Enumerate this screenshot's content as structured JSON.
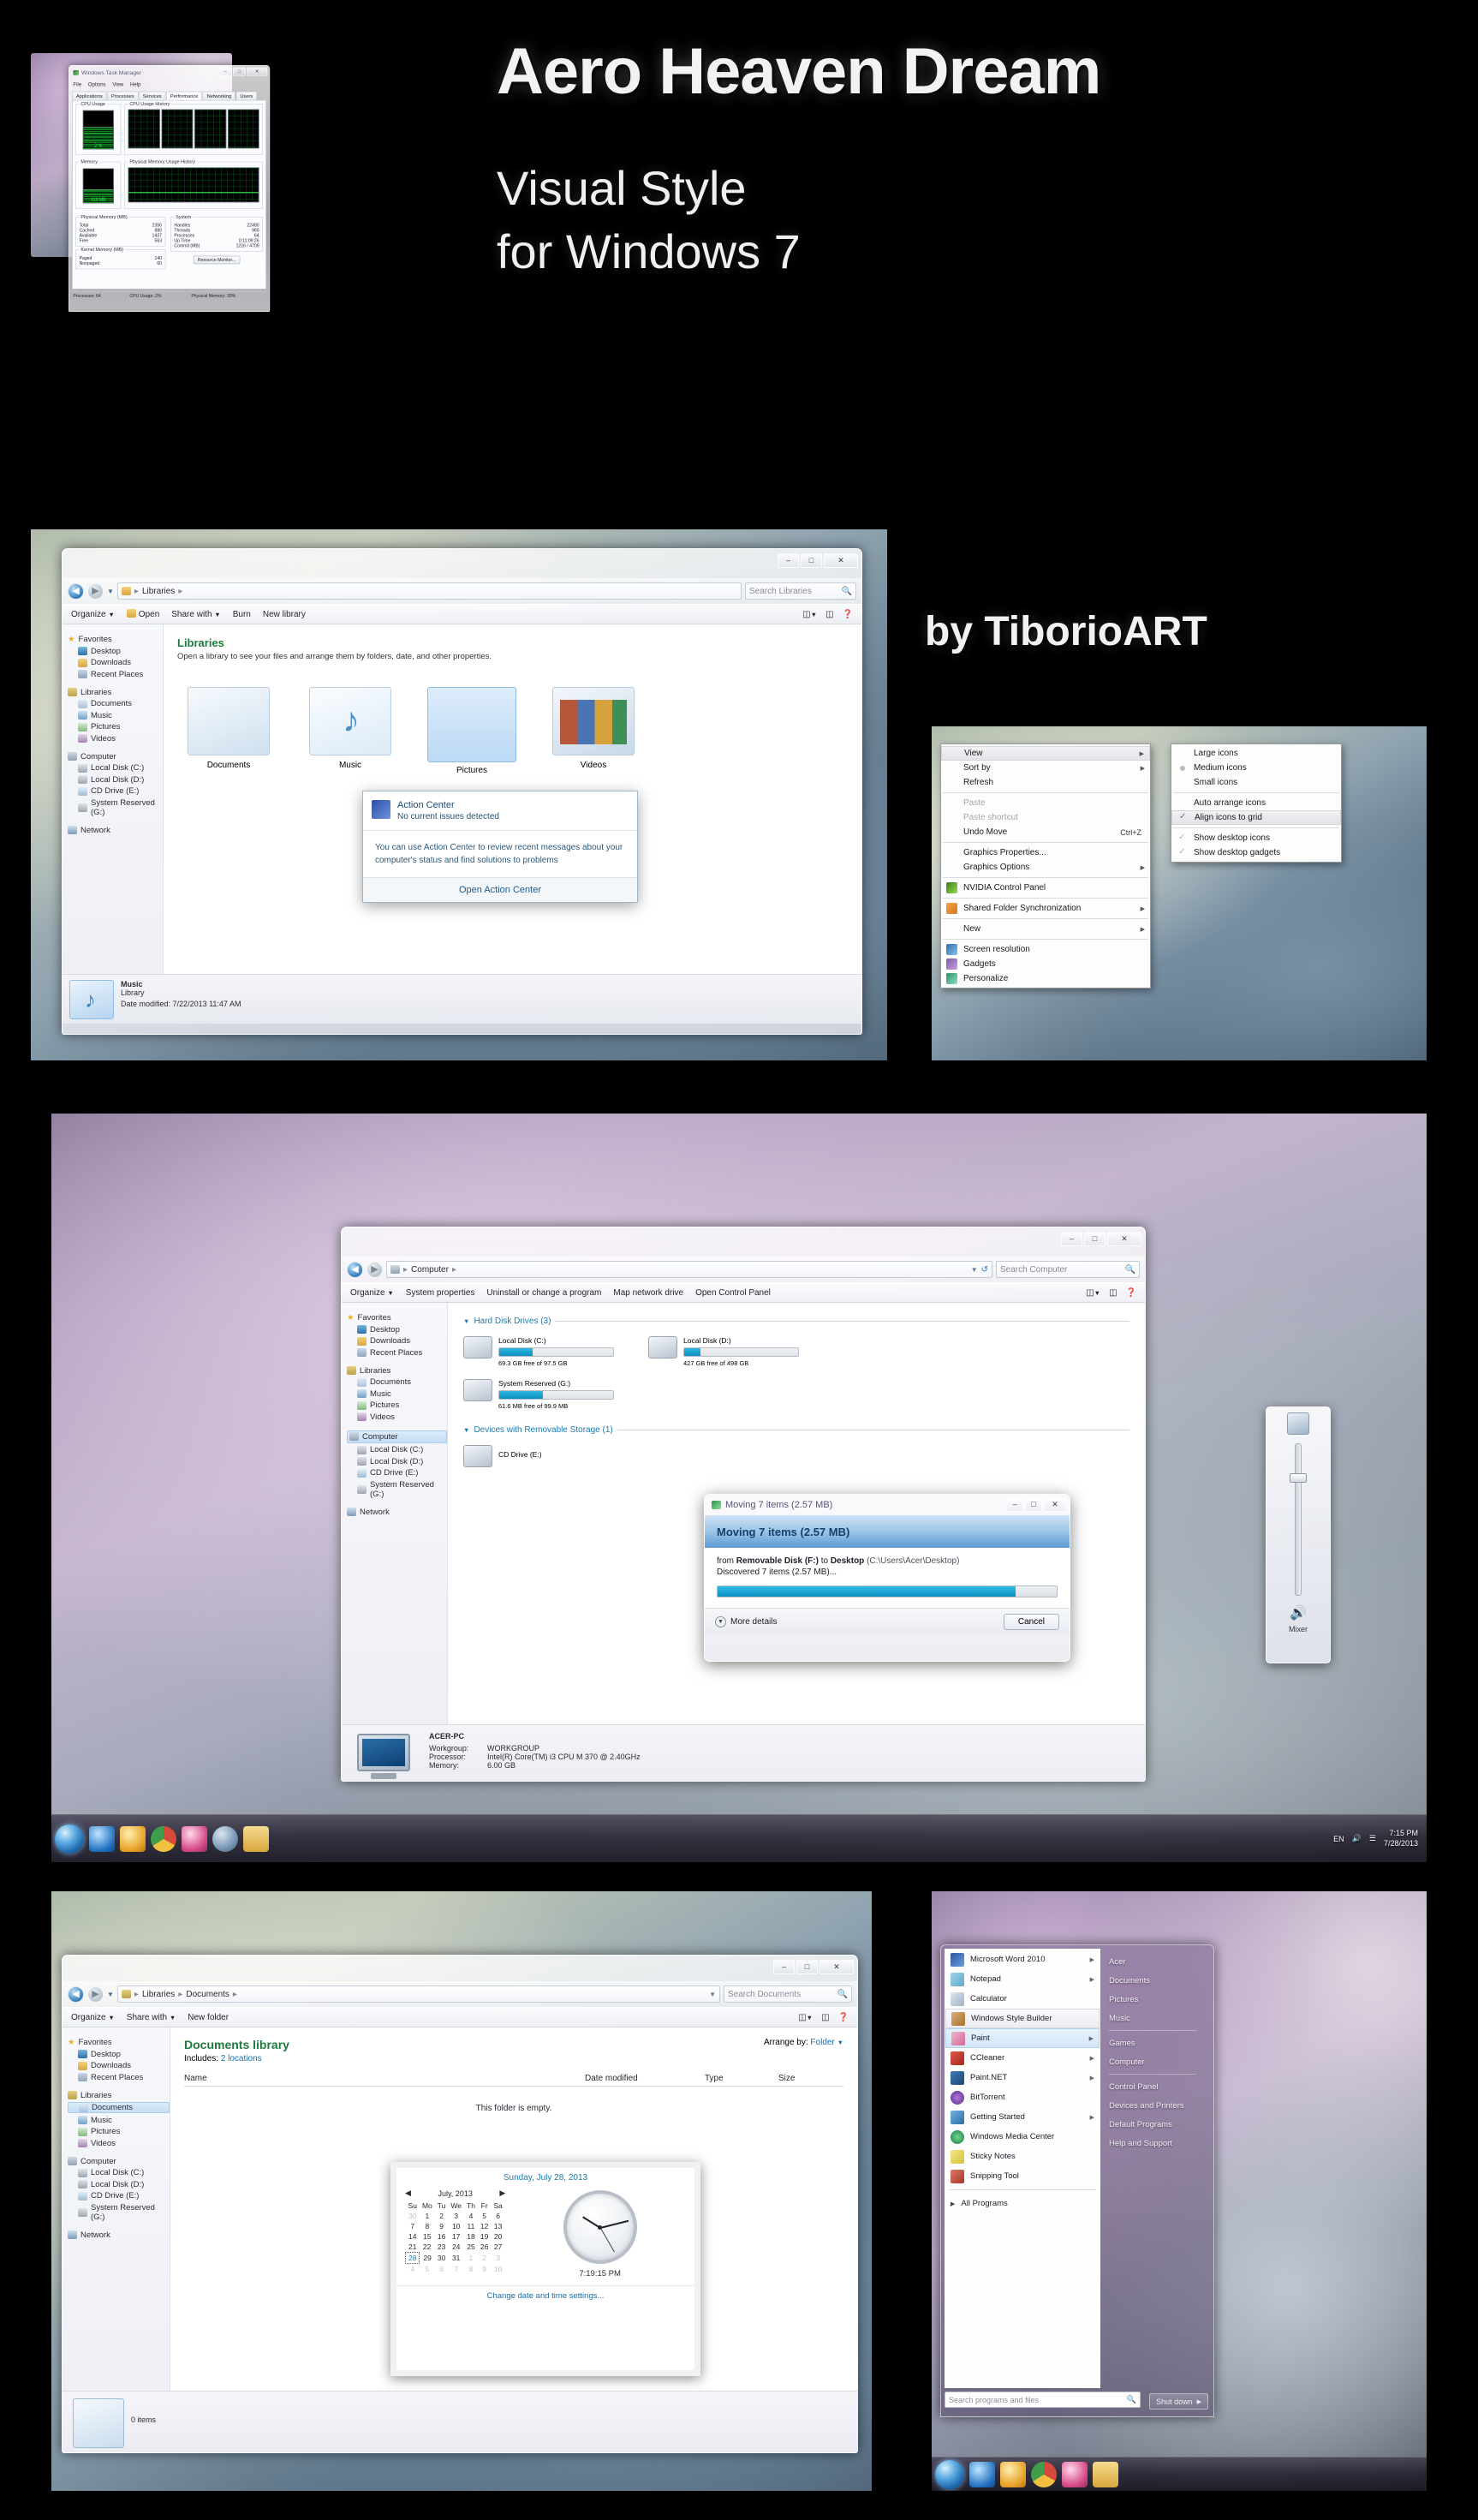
{
  "hero": {
    "title": "Aero Heaven Dream",
    "subtitle_line1": "Visual Style",
    "subtitle_line2": "for Windows 7",
    "author": "by TiborioART"
  },
  "task_manager": {
    "title": "Windows Task Manager",
    "menus": [
      "File",
      "Options",
      "View",
      "Help"
    ],
    "tabs": [
      "Applications",
      "Processes",
      "Services",
      "Performance",
      "Networking",
      "Users"
    ],
    "active_tab": "Performance",
    "groups": {
      "cpu_usage": "CPU Usage",
      "cpu_usage_history": "CPU Usage History",
      "memory": "Memory",
      "physical_memory_usage_history": "Physical Memory Usage History"
    },
    "cpu_meter_label": "2 %",
    "cpu_meter_percent": 2,
    "memory_meter_label": "919 MB",
    "memory_meter_percent": 39,
    "physical_memory": {
      "label": "Physical Memory (MB)",
      "rows": [
        {
          "name": "Total",
          "value": "2356"
        },
        {
          "name": "Cached",
          "value": "880"
        },
        {
          "name": "Available",
          "value": "1437"
        },
        {
          "name": "Free",
          "value": "563"
        }
      ]
    },
    "kernel_memory": {
      "label": "Kernel Memory (MB)",
      "rows": [
        {
          "name": "Paged",
          "value": "140"
        },
        {
          "name": "Nonpaged",
          "value": "60"
        }
      ]
    },
    "system": {
      "label": "System",
      "rows": [
        {
          "name": "Handles",
          "value": "22490"
        },
        {
          "name": "Threads",
          "value": "965"
        },
        {
          "name": "Processes",
          "value": "64"
        },
        {
          "name": "Up Time",
          "value": "0:11:09:26"
        },
        {
          "name": "Commit (MB)",
          "value": "1216 / 4709"
        }
      ]
    },
    "resource_monitor_button": "Resource Monitor...",
    "status": {
      "processes": "Processes: 64",
      "cpu_usage": "CPU Usage: 2%",
      "physical_memory": "Physical Memory: 39%"
    }
  },
  "libraries_window": {
    "breadcrumb": [
      "Libraries"
    ],
    "search_placeholder": "Search Libraries",
    "toolbar": [
      "Organize",
      "Open",
      "Share with",
      "Burn",
      "New library"
    ],
    "nav": {
      "favorites": {
        "label": "Favorites",
        "items": [
          "Desktop",
          "Downloads",
          "Recent Places"
        ]
      },
      "libraries": {
        "label": "Libraries",
        "items": [
          "Documents",
          "Music",
          "Pictures",
          "Videos"
        ]
      },
      "computer": {
        "label": "Computer",
        "items": [
          "Local Disk (C:)",
          "Local Disk (D:)",
          "CD Drive (E:)",
          "System Reserved (G:)"
        ]
      },
      "network": {
        "label": "Network"
      }
    },
    "heading": "Libraries",
    "subheading": "Open a library to see your files and arrange them by folders, date, and other properties.",
    "tiles": [
      {
        "label": "Documents"
      },
      {
        "label": "Music"
      },
      {
        "label": "Pictures"
      },
      {
        "label": "Videos"
      }
    ],
    "selected_tile": "Pictures",
    "details": {
      "name": "Music",
      "kind": "Library",
      "date_modified_label": "Date modified:",
      "date_modified": "7/22/2013 11:47 AM"
    },
    "action_center": {
      "title": "Action Center",
      "subtitle": "No current issues detected",
      "body": "You can use Action Center to review recent messages about your computer's status and find solutions to problems",
      "link": "Open Action Center"
    }
  },
  "desktop_context_menu": {
    "items": [
      {
        "label": "View",
        "submenu": true,
        "highlighted": true
      },
      {
        "label": "Sort by",
        "submenu": true
      },
      {
        "label": "Refresh"
      },
      {
        "sep": true
      },
      {
        "label": "Paste",
        "disabled": true
      },
      {
        "label": "Paste shortcut",
        "disabled": true
      },
      {
        "label": "Undo Move",
        "shortcut": "Ctrl+Z"
      },
      {
        "sep": true
      },
      {
        "label": "Graphics Properties..."
      },
      {
        "label": "Graphics Options",
        "submenu": true
      },
      {
        "sep": true
      },
      {
        "label": "NVIDIA Control Panel",
        "icon": "#4a8f20"
      },
      {
        "sep": true
      },
      {
        "label": "Shared Folder Synchronization",
        "submenu": true,
        "icon": "#e08a22"
      },
      {
        "sep": true
      },
      {
        "label": "New",
        "submenu": true
      },
      {
        "sep": true
      },
      {
        "label": "Screen resolution",
        "icon": "#2f6fae"
      },
      {
        "label": "Gadgets",
        "icon": "#7a5aa8"
      },
      {
        "label": "Personalize",
        "icon": "#2a8f6a"
      }
    ],
    "submenu": [
      {
        "label": "Large icons"
      },
      {
        "label": "Medium icons",
        "bullet": true
      },
      {
        "label": "Small icons"
      },
      {
        "sep": true
      },
      {
        "label": "Auto arrange icons"
      },
      {
        "label": "Align icons to grid",
        "check": true,
        "highlighted": true
      },
      {
        "sep": true
      },
      {
        "label": "Show desktop icons",
        "check": true
      },
      {
        "label": "Show desktop gadgets",
        "check": true
      }
    ]
  },
  "computer_window": {
    "breadcrumb": [
      "Computer"
    ],
    "search_placeholder": "Search Computer",
    "toolbar": [
      "Organize",
      "System properties",
      "Uninstall or change a program",
      "Map network drive",
      "Open Control Panel"
    ],
    "nav": {
      "favorites": {
        "label": "Favorites",
        "items": [
          "Desktop",
          "Downloads",
          "Recent Places"
        ]
      },
      "libraries": {
        "label": "Libraries",
        "items": [
          "Documents",
          "Music",
          "Pictures",
          "Videos"
        ]
      },
      "computer": {
        "label": "Computer",
        "items": [
          "Local Disk (C:)",
          "Local Disk (D:)",
          "CD Drive (E:)",
          "System Reserved (G:)"
        ]
      },
      "network": {
        "label": "Network"
      }
    },
    "groups": [
      {
        "header": "Hard Disk Drives (3)",
        "drives": [
          {
            "name": "Local Disk (C:)",
            "free_text": "69.3 GB free of 97.5 GB",
            "used_pct": 29
          },
          {
            "name": "Local Disk (D:)",
            "free_text": "427 GB free of 498 GB",
            "used_pct": 14
          },
          {
            "name": "System Reserved (G:)",
            "free_text": "61.6 MB free of 99.9 MB",
            "used_pct": 38
          }
        ]
      },
      {
        "header": "Devices with Removable Storage (1)",
        "drives": [
          {
            "name": "CD Drive (E:)",
            "free_text": "",
            "used_pct": 0
          }
        ]
      }
    ],
    "details": {
      "computer_name": "ACER-PC",
      "rows": [
        {
          "name": "Workgroup:",
          "value": "WORKGROUP"
        },
        {
          "name": "Processor:",
          "value": "Intel(R) Core(TM) i3 CPU    M 370  @ 2.40GHz"
        },
        {
          "name": "Memory:",
          "value": "6.00 GB"
        }
      ]
    }
  },
  "move_dialog": {
    "titlebar": "Moving 7 items (2.57 MB)",
    "heading": "Moving 7 items (2.57 MB)",
    "from_label": "from",
    "source": "Removable Disk (F:)",
    "to_label": "to",
    "destination": "Desktop",
    "destination_path": "(C:\\Users\\Acer\\Desktop)",
    "status": "Discovered 7 items (2.57 MB)...",
    "progress_pct": 88,
    "more_details": "More details",
    "cancel": "Cancel"
  },
  "volume_gadget": {
    "label": "Mixer"
  },
  "desktop_taskbar": {
    "language": "EN",
    "time": "7:15 PM",
    "date": "7/28/2013"
  },
  "documents_window": {
    "breadcrumb": [
      "Libraries",
      "Documents"
    ],
    "search_placeholder": "Search Documents",
    "toolbar": [
      "Organize",
      "Share with",
      "New folder"
    ],
    "nav": {
      "favorites": {
        "label": "Favorites",
        "items": [
          "Desktop",
          "Downloads",
          "Recent Places"
        ]
      },
      "libraries": {
        "label": "Libraries",
        "items": [
          "Documents",
          "Music",
          "Pictures",
          "Videos"
        ]
      },
      "computer": {
        "label": "Computer",
        "items": [
          "Local Disk (C:)",
          "Local Disk (D:)",
          "CD Drive (E:)",
          "System Reserved (G:)"
        ]
      },
      "network": {
        "label": "Network"
      }
    },
    "heading": "Documents library",
    "includes_label": "Includes:",
    "includes_value": "2 locations",
    "arrange_label": "Arrange by:",
    "arrange_value": "Folder",
    "columns": [
      "Name",
      "Date modified",
      "Type",
      "Size"
    ],
    "empty_message": "This folder is empty.",
    "status": "0 items",
    "selected_nav_item": "Music"
  },
  "calendar_gadget": {
    "full_date": "Sunday, July 28, 2013",
    "month_year": "July, 2013",
    "weekdays": [
      "Su",
      "Mo",
      "Tu",
      "We",
      "Th",
      "Fr",
      "Sa"
    ],
    "weeks": [
      [
        "30",
        "1",
        "2",
        "3",
        "4",
        "5",
        "6"
      ],
      [
        "7",
        "8",
        "9",
        "10",
        "11",
        "12",
        "13"
      ],
      [
        "14",
        "15",
        "16",
        "17",
        "18",
        "19",
        "20"
      ],
      [
        "21",
        "22",
        "23",
        "24",
        "25",
        "26",
        "27"
      ],
      [
        "28",
        "29",
        "30",
        "31",
        "1",
        "2",
        "3"
      ],
      [
        "4",
        "5",
        "6",
        "7",
        "8",
        "9",
        "10"
      ]
    ],
    "dim_cells": [
      "0:0",
      "4:4",
      "4:5",
      "4:6",
      "5:0",
      "5:1",
      "5:2",
      "5:3",
      "5:4",
      "5:5",
      "5:6"
    ],
    "selected": "4:0",
    "clock_time": "7:19:15 PM",
    "link": "Change date and time settings..."
  },
  "start_menu": {
    "programs": [
      {
        "label": "Microsoft Word 2010",
        "submenu": true,
        "color": "#2a5699"
      },
      {
        "label": "Notepad",
        "submenu": true,
        "color": "#9fd4e8"
      },
      {
        "label": "Calculator",
        "color": "#c9d6e2"
      },
      {
        "label": "Windows Style Builder",
        "highlight": "grey",
        "color": "#d8b07a"
      },
      {
        "label": "Paint",
        "submenu": true,
        "highlight": "blue",
        "color": "#e8a9c0"
      },
      {
        "label": "CCleaner",
        "submenu": true,
        "color": "#c3342a"
      },
      {
        "label": "Paint.NET",
        "submenu": true,
        "color": "#2c5f96"
      },
      {
        "label": "BitTorrent",
        "color": "#7a3aa8"
      },
      {
        "label": "Getting Started",
        "submenu": true,
        "color": "#3f87c4"
      },
      {
        "label": "Windows Media Center",
        "color": "#2a8f4a"
      },
      {
        "label": "Sticky Notes",
        "color": "#e8d24a"
      },
      {
        "label": "Snipping Tool",
        "color": "#c7554a"
      }
    ],
    "all_programs": "All Programs",
    "search_placeholder": "Search programs and files",
    "right_items": [
      {
        "label": "Acer"
      },
      {
        "label": "Documents"
      },
      {
        "label": "Pictures"
      },
      {
        "label": "Music"
      },
      {
        "sep": true
      },
      {
        "label": "Games"
      },
      {
        "label": "Computer"
      },
      {
        "sep": true
      },
      {
        "label": "Control Panel"
      },
      {
        "label": "Devices and Printers"
      },
      {
        "label": "Default Programs"
      },
      {
        "label": "Help and Support"
      }
    ],
    "shutdown": "Shut down"
  },
  "colors": {
    "accent_green": "#1f7a3d",
    "accent_blue": "#1c7ab0",
    "progress_blue": "#0a8ec0",
    "orb_blue": "#1f68ad"
  }
}
